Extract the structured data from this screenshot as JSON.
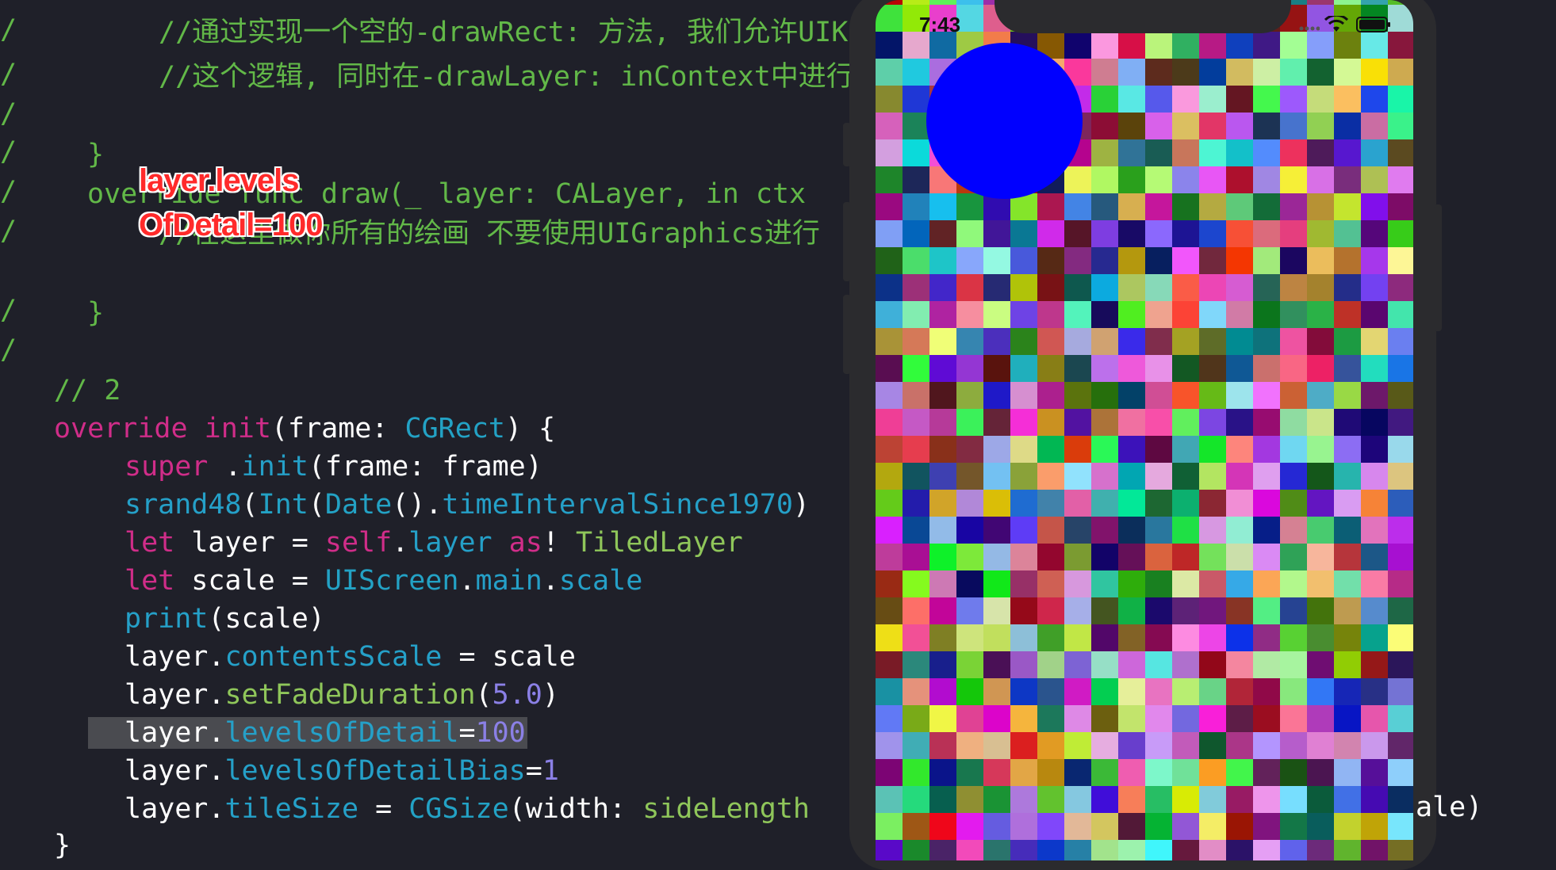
{
  "editor": {
    "gutter_marks": [
      "/",
      "/",
      "/",
      "/",
      "/",
      "/",
      "/",
      "/"
    ],
    "comment_line_1": "//通过实现一个空的-drawRect: 方法, 我们允许UIK",
    "comment_line_2": "//这个逻辑, 同时在-drawLayer: inContext中进行",
    "close_brace_1": "}",
    "override_line": "override func draw(_ layer: CALayer, in ctx",
    "comment_line_3": "//在这里做你所有的绘画 不要使用UIGraphics进行",
    "close_brace_2": "}",
    "comment_2": "// 2",
    "init_kw_override": "override",
    "init_kw_init": "init",
    "init_params": "(frame: ",
    "init_type": "CGRect",
    "init_tail": ") {",
    "super_kw": "super",
    "super_dot": " .",
    "super_init": "init",
    "super_args": "(frame: frame)",
    "srand_fn": "srand48",
    "srand_p1": "(",
    "srand_int": "Int",
    "srand_p2": "(",
    "srand_date": "Date",
    "srand_p3": "().",
    "srand_prop": "timeIntervalSince1970",
    "srand_p4": ")",
    "let1_kw": "let",
    "let1_name": " layer = ",
    "let1_self": "self",
    "let1_dot": ".",
    "let1_layer": "layer",
    "let1_as": " as",
    "let1_bang": "! ",
    "let1_type": "TiledLayer",
    "let2_kw": "let",
    "let2_name": " scale = ",
    "let2_type": "UIScreen",
    "let2_dot": ".",
    "let2_main": "main",
    "let2_dot2": ".",
    "let2_scale": "scale",
    "print_fn": "print",
    "print_args": "(scale)",
    "cs_obj": "layer.",
    "cs_prop": "contentsScale",
    "cs_tail": " = scale",
    "fade_obj": "layer.",
    "fade_fn": "setFadeDuration",
    "fade_p1": "(",
    "fade_num": "5.0",
    "fade_p2": ")",
    "lod_obj": "layer.",
    "lod_prop": "levelsOfDetail",
    "lod_eq": "=",
    "lod_num": "100",
    "lodb_obj": "layer.",
    "lodb_prop": "levelsOfDetailBias",
    "lodb_eq": "=",
    "lodb_num": "1",
    "tile_obj": "layer.",
    "tile_prop": "tileSize",
    "tile_eq": " = ",
    "tile_type": "CGSize",
    "tile_args": "(width: ",
    "tile_var": "sideLength",
    "tile_overflow": "ale)",
    "final_brace": "}"
  },
  "annotation": {
    "line1": "layer.levels",
    "line2": "OfDetail=100"
  },
  "simulator": {
    "time": "7:43",
    "circle_color": "#0000ff"
  }
}
